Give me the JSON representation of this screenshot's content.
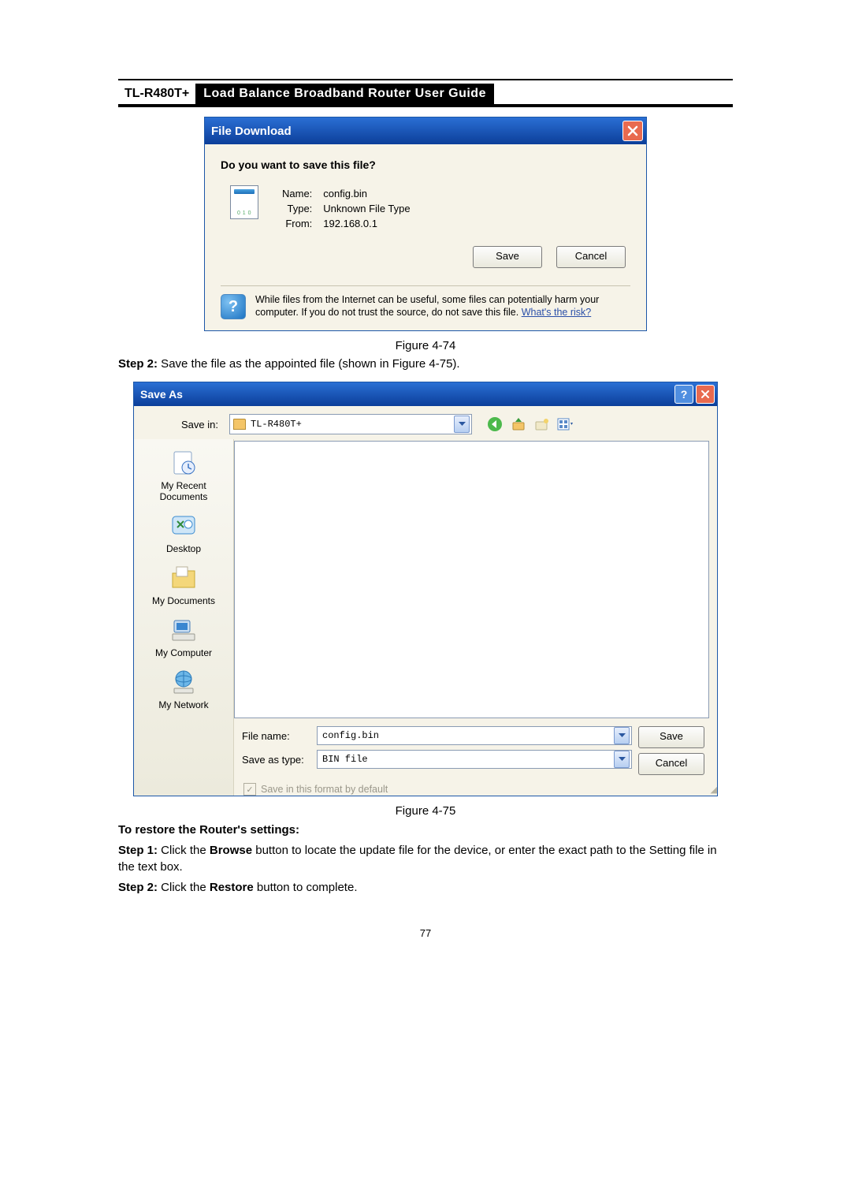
{
  "header": {
    "model": "TL-R480T+",
    "title": "Load  Balance  Broadband  Router  User  Guide"
  },
  "dlg1": {
    "title": "File Download",
    "question": "Do you want to save this file?",
    "name_label": "Name:",
    "name_value": "config.bin",
    "type_label": "Type:",
    "type_value": "Unknown File Type",
    "from_label": "From:",
    "from_value": "192.168.0.1",
    "save_btn": "Save",
    "cancel_btn": "Cancel",
    "warning_text": "While files from the Internet can be useful, some files can potentially harm your computer. If you do not trust the source, do not save this file. ",
    "risk_link": "What's the risk?"
  },
  "fig1_caption": "Figure 4-74",
  "step2a_label": "Step 2:",
  "step2a_text": "  Save the file as the appointed file (shown in Figure 4-75).",
  "dlg2": {
    "title": "Save As",
    "savein_label": "Save in:",
    "savein_value": "TL-R480T+",
    "places": {
      "recent": "My Recent Documents",
      "desktop": "Desktop",
      "mydocs": "My Documents",
      "mycomp": "My Computer",
      "mynet": "My Network"
    },
    "filename_label": "File name:",
    "filename_value": "config.bin",
    "saveastype_label": "Save as type:",
    "saveastype_value": "BIN file",
    "save_btn": "Save",
    "cancel_btn": "Cancel",
    "save_format": "Save in this format by default"
  },
  "fig2_caption": "Figure 4-75",
  "restore_heading": "To restore the Router's settings:",
  "restore_step1_label": "Step 1:",
  "restore_step1_a": "  Click the ",
  "restore_step1_b": "Browse",
  "restore_step1_c": " button to locate the update file for the device, or enter the exact path to the Setting file in the text box.",
  "restore_step2_label": "Step 2:",
  "restore_step2_a": "  Click the ",
  "restore_step2_b": "Restore",
  "restore_step2_c": " button to complete.",
  "page_number": "77"
}
